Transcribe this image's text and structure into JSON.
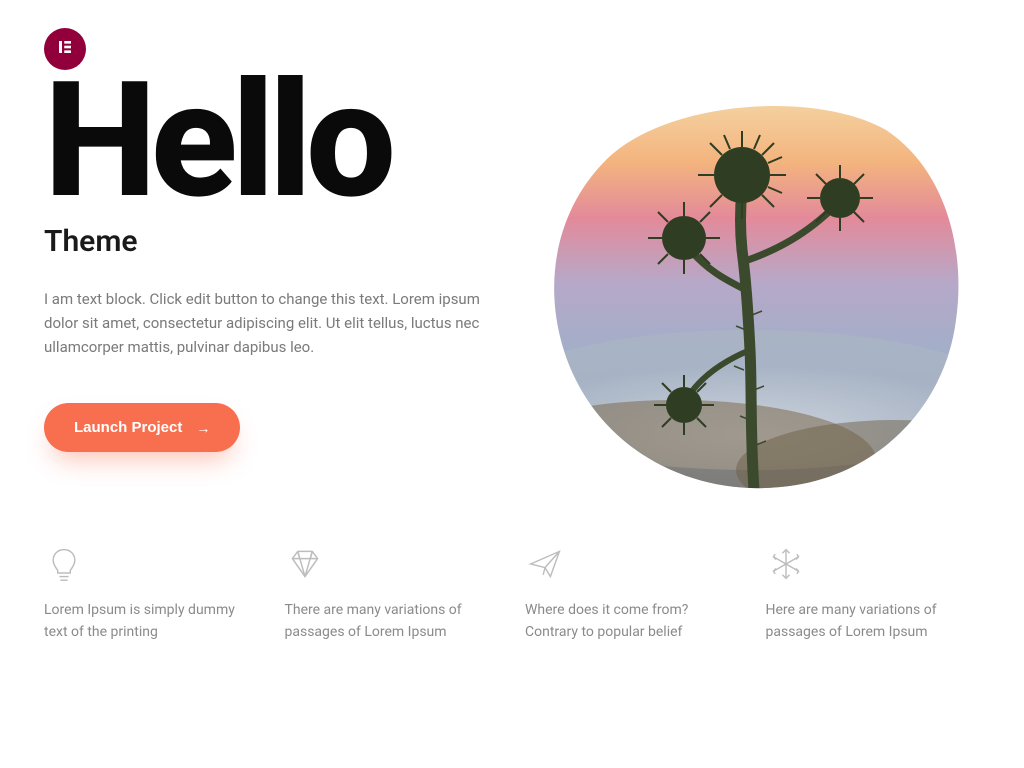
{
  "logo": {
    "icon_name": "elementor-icon"
  },
  "hero": {
    "title": "Hello",
    "subtitle": "Theme",
    "body": "I am text block. Click edit button to change this text. Lorem ipsum dolor sit amet, consectetur adipiscing elit. Ut elit tellus, luctus nec ullamcorper mattis, pulvinar dapibus leo.",
    "cta_label": "Launch Project",
    "cta_icon": "arrow-right-icon",
    "image_alt": "thistle-plant-sunset"
  },
  "colors": {
    "accent": "#f86f4f",
    "brand": "#92003b"
  },
  "features": [
    {
      "icon": "lightbulb-icon",
      "text": "Lorem Ipsum is simply dummy text of the printing"
    },
    {
      "icon": "diamond-icon",
      "text": "There are many variations of passages of Lorem Ipsum"
    },
    {
      "icon": "paper-plane-icon",
      "text": "Where does it come from? Contrary to popular belief"
    },
    {
      "icon": "snowflake-icon",
      "text": "Here are many variations of passages of Lorem Ipsum"
    }
  ]
}
